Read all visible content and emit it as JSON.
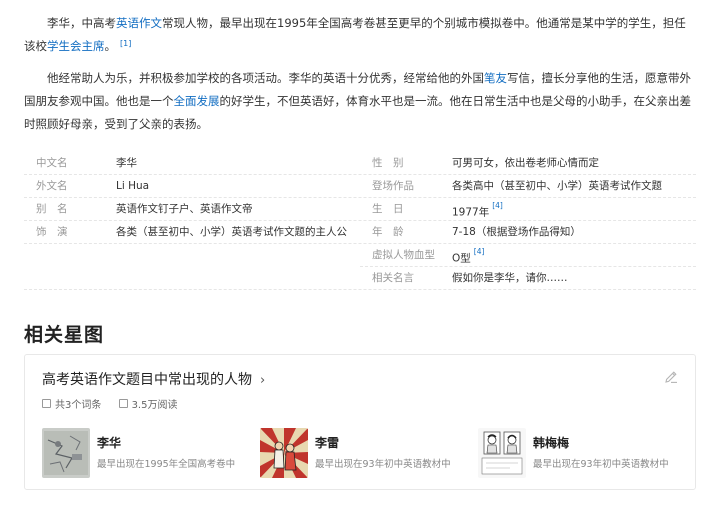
{
  "intro": {
    "p1": {
      "t1": "李华，中高考",
      "link1": "英语作文",
      "t2": "常现人物，最早出现在1995年全国高考卷甚至更早的个别城市模拟卷中。他通常是某中学的学生，担任该校",
      "link2": "学生会主席",
      "t3": "。",
      "ref": "[1]"
    },
    "p2": {
      "t1": "他经常助人为乐，并积极参加学校的各项活动。李华的英语十分优秀，经常给他的外国",
      "link1": "笔友",
      "t2": "写信，擅长分享他的生活，愿意带外国朋友参观中国。他也是一个",
      "link2": "全面发展",
      "t3": "的好学生，不但英语好，体育水平也是一流。他在日常生活中也是父母的小助手，在父亲出差时照顾好母亲，受到了父亲的表扬。"
    }
  },
  "infobox": {
    "left": [
      {
        "key": "中文名",
        "value": "李华"
      },
      {
        "key": "外文名",
        "value": "Li Hua"
      },
      {
        "key": "别　名",
        "value": "英语作文钉子户、英语作文帝"
      },
      {
        "key": "饰　演",
        "value": "各类（甚至初中、小学）英语考试作文题的主人公"
      }
    ],
    "right": [
      {
        "key": "性　别",
        "value": "可男可女，依出卷老师心情而定",
        "ref": ""
      },
      {
        "key": "登场作品",
        "value": "各类高中（甚至初中、小学）英语考试作文题",
        "ref": ""
      },
      {
        "key": "生　日",
        "value": "1977年",
        "ref": "[4]"
      },
      {
        "key": "年　龄",
        "value": "7-18（根据登场作品得知）",
        "ref": ""
      },
      {
        "key": "虚拟人物血型",
        "value": "O型",
        "ref": "[4]"
      },
      {
        "key": "相关名言",
        "value": "假如你是李华，请你……",
        "ref": ""
      }
    ]
  },
  "related": {
    "section_title": "相关星图",
    "card_title": "高考英语作文题目中常出现的人物",
    "chevron": "›",
    "count_label": "共3个词条",
    "reads_label": "3.5万阅读",
    "edit_icon": "pencil-icon",
    "people": [
      {
        "name": "李华",
        "desc": "最早出现在1995年全国高考卷中"
      },
      {
        "name": "李雷",
        "desc": "最早出现在93年初中英语教材中"
      },
      {
        "name": "韩梅梅",
        "desc": "最早出现在93年初中英语教材中"
      }
    ]
  },
  "colors": {
    "link": "#136ec2",
    "key": "#999999",
    "text": "#333333"
  }
}
